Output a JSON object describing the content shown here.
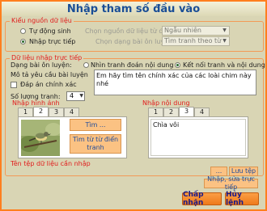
{
  "window": {
    "title": "Nhập tham số đầu vào"
  },
  "source_group": {
    "legend": "Kiểu nguồn dữ liệu",
    "radio_auto": "Tự động sinh",
    "radio_direct": "Nhập trực tiếp",
    "source_label": "Chọn nguồn dữ liệu từ điển",
    "source_value": "Ngẫu nhiên",
    "type_label": "Chọn dạng bài ôn luyện",
    "type_value": "Tìm tranh theo từ"
  },
  "direct_group": {
    "legend": "Dữ liệu nhập trực tiếp",
    "type_label": "Dạng bài ôn luyện:",
    "opt_match_text": "Nhìn tranh đoán nội dung",
    "opt_connect": "Kết nối tranh và nội dung",
    "req_label": "Mô tả yêu cầu bài luyện",
    "req_text": "Em hãy tìm tên chính xác của các loài chim này nhé",
    "exact_answer": "Đáp án chính xác",
    "count_label": "Số lượng tranh:",
    "count_value": "4",
    "images_legend": "Nhập hình ảnh",
    "content_legend": "Nhập nội dung",
    "image_tabs": [
      "1",
      "2",
      "3",
      "4"
    ],
    "content_tabs": [
      "1",
      "2",
      "3",
      "4"
    ],
    "btn_find": "Tìm ...",
    "btn_find_dict": "Tìm từ từ điển tranh",
    "content_text": "Chìa vôi",
    "file_legend": "Tên tệp dữ liệu cần nhập",
    "btn_browse": "...",
    "btn_save": "Lưu tệp",
    "btn_edit": "Nhập, sửa trực tiếp"
  },
  "footer": {
    "accept": "Chấp nhận",
    "cancel": "Hủy lệnh"
  },
  "colors": {
    "frame": "#ff7f1e",
    "background": "#d9d5b4",
    "legend_text": "#e11d1d",
    "title_text": "#1a4e96",
    "orange_button": "#fbc283"
  },
  "icons": {
    "arrow": "▼",
    "bird_image": "bird-on-branch"
  }
}
